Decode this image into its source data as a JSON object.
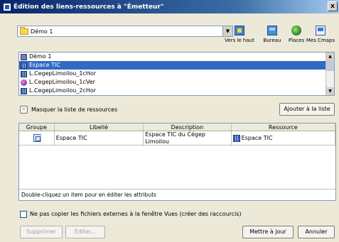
{
  "window": {
    "title": "Édition des liens-ressources à \"Émetteur\"",
    "close": "x"
  },
  "location": {
    "selected": "Démo 1"
  },
  "toolbar": {
    "up": "Vers le haut",
    "desktop": "Bureau",
    "places": "Places",
    "mycmaps": "Mes Cmaps"
  },
  "resources": [
    {
      "label": "Démo 1",
      "icon": "network-icon",
      "selected": false
    },
    {
      "label": "Espace TIC",
      "icon": "grid-icon",
      "selected": true
    },
    {
      "label": "L.CegepLimoilou_1cHor",
      "icon": "grid-icon",
      "selected": false
    },
    {
      "label": "L.CegepLimoilou_1cVer",
      "icon": "ball-icon",
      "selected": false
    },
    {
      "label": "L.CegepLimoilou_2cHor",
      "icon": "grid-icon",
      "selected": false
    }
  ],
  "actions": {
    "collapse_symbol": "-",
    "hide_list": "Masquer la liste de ressources",
    "add_to_list": "Ajouter à la liste"
  },
  "table": {
    "headers": [
      "Groupe",
      "Libellé",
      "Description",
      "Ressource"
    ],
    "rows": [
      {
        "label": "Espace TIC",
        "description": "Espace TIC du Cégep Limoilou",
        "resource": "Espace TIC"
      }
    ],
    "hint": "Double-cliquez un item pour en éditer les attributs"
  },
  "options": {
    "no_copy": "Ne pas copier les fichiers externes à la fenêtre Vues (créer des raccourcis)"
  },
  "buttons": {
    "delete": "Supprimer",
    "edit": "Éditer...",
    "update": "Mettre à jour",
    "cancel": "Annuler"
  }
}
